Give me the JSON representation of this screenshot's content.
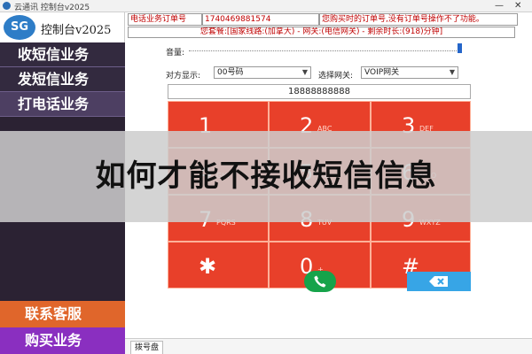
{
  "window": {
    "title": "云通讯 控制台v2025",
    "minimize": "—",
    "close": "✕"
  },
  "sidebar": {
    "logo_text": "SG",
    "app_name": "控制台v2025",
    "items": [
      {
        "label": "收短信业务"
      },
      {
        "label": "发短信业务"
      },
      {
        "label": "打电话业务"
      }
    ],
    "contact_label": "联系客服",
    "buy_label": "购买业务"
  },
  "header": {
    "order_label": "电话业务订单号",
    "order_value": "1740469881574",
    "order_hint": "您购买时的订单号,没有订单号操作不了功能。",
    "package_line": "您套餐:[国家线路:(加拿大) - 网关:(电信网关) - 剩余时长:(918)分钟]"
  },
  "controls": {
    "volume_label": "音量:",
    "volume_level": 1.0,
    "caller_label": "对方显示:",
    "caller_value": "00号码",
    "gateway_label": "选择网关:",
    "gateway_value": "VOIP网关",
    "phone_number": "18888888888"
  },
  "keypad": [
    {
      "digit": "1",
      "letters": ""
    },
    {
      "digit": "2",
      "letters": "ABC"
    },
    {
      "digit": "3",
      "letters": "DEF"
    },
    {
      "digit": "4",
      "letters": "GHI"
    },
    {
      "digit": "5",
      "letters": "JKL"
    },
    {
      "digit": "6",
      "letters": "MNO"
    },
    {
      "digit": "7",
      "letters": "PQRS"
    },
    {
      "digit": "8",
      "letters": "TUV"
    },
    {
      "digit": "9",
      "letters": "WXYZ"
    },
    {
      "digit": "✱",
      "letters": ""
    },
    {
      "digit": "0",
      "letters": "+"
    },
    {
      "digit": "#",
      "letters": ""
    }
  ],
  "tabs": [
    {
      "label": "拨号盘"
    }
  ],
  "overlay": {
    "text": "如何才能不接收短信信息"
  },
  "colors": {
    "key_red": "#e8402a",
    "sidebar_dark": "#2b2233",
    "contact_orange": "#e0662b",
    "buy_purple": "#8a2fc0",
    "call_green": "#16a34a",
    "delete_blue": "#37a5e6"
  },
  "icons": {
    "call": "phone-icon",
    "delete": "backspace-icon",
    "dropdown": "chevron-down-icon"
  }
}
